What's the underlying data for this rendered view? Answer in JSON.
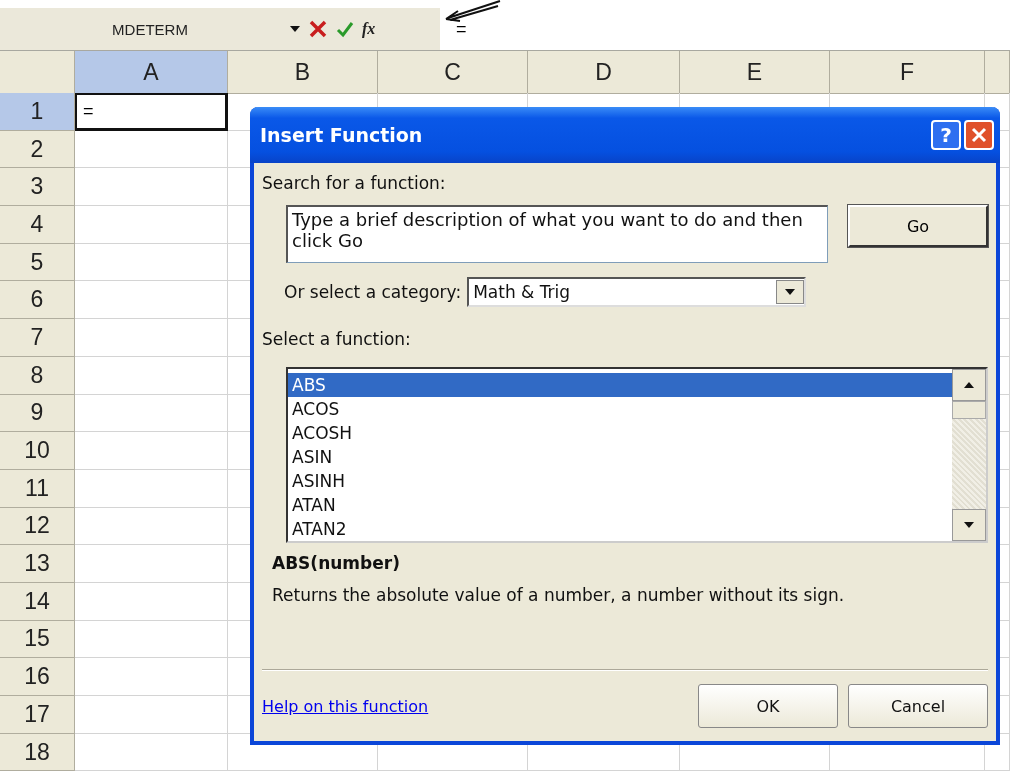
{
  "formula_bar": {
    "name_box": "MDETERM",
    "formula": "=",
    "function_button": "fx"
  },
  "sheet": {
    "columns": [
      {
        "label": "A",
        "selected": true
      },
      {
        "label": "B",
        "selected": false
      },
      {
        "label": "C",
        "selected": false
      },
      {
        "label": "D",
        "selected": false
      },
      {
        "label": "E",
        "selected": false
      },
      {
        "label": "F",
        "selected": false
      }
    ],
    "rows": [
      {
        "label": "1",
        "selected": true
      },
      {
        "label": "2",
        "selected": false
      },
      {
        "label": "3",
        "selected": false
      },
      {
        "label": "4",
        "selected": false
      },
      {
        "label": "5",
        "selected": false
      },
      {
        "label": "6",
        "selected": false
      },
      {
        "label": "7",
        "selected": false
      },
      {
        "label": "8",
        "selected": false
      },
      {
        "label": "9",
        "selected": false
      },
      {
        "label": "10",
        "selected": false
      },
      {
        "label": "11",
        "selected": false
      },
      {
        "label": "12",
        "selected": false
      },
      {
        "label": "13",
        "selected": false
      },
      {
        "label": "14",
        "selected": false
      },
      {
        "label": "15",
        "selected": false
      },
      {
        "label": "16",
        "selected": false
      },
      {
        "label": "17",
        "selected": false
      },
      {
        "label": "18",
        "selected": false
      }
    ],
    "active_cell": {
      "value": "="
    }
  },
  "dialog": {
    "title": "Insert Function",
    "help_button": "?",
    "search_label": "Search for a function:",
    "search": {
      "placeholder": "Type a brief description of what you want to do and then click Go"
    },
    "go_button": "Go",
    "category_label": "Or select a category:",
    "category": {
      "value": "Math & Trig"
    },
    "function_label": "Select a function:",
    "functions": [
      {
        "name": "ABS",
        "selected": true
      },
      {
        "name": "ACOS",
        "selected": false
      },
      {
        "name": "ACOSH",
        "selected": false
      },
      {
        "name": "ASIN",
        "selected": false
      },
      {
        "name": "ASINH",
        "selected": false
      },
      {
        "name": "ATAN",
        "selected": false
      },
      {
        "name": "ATAN2",
        "selected": false
      }
    ],
    "signature": "ABS(number)",
    "description": "Returns the absolute value of a number, a number without its sign.",
    "help_link": "Help on this function",
    "buttons": [
      "OK",
      "Cancel"
    ]
  }
}
